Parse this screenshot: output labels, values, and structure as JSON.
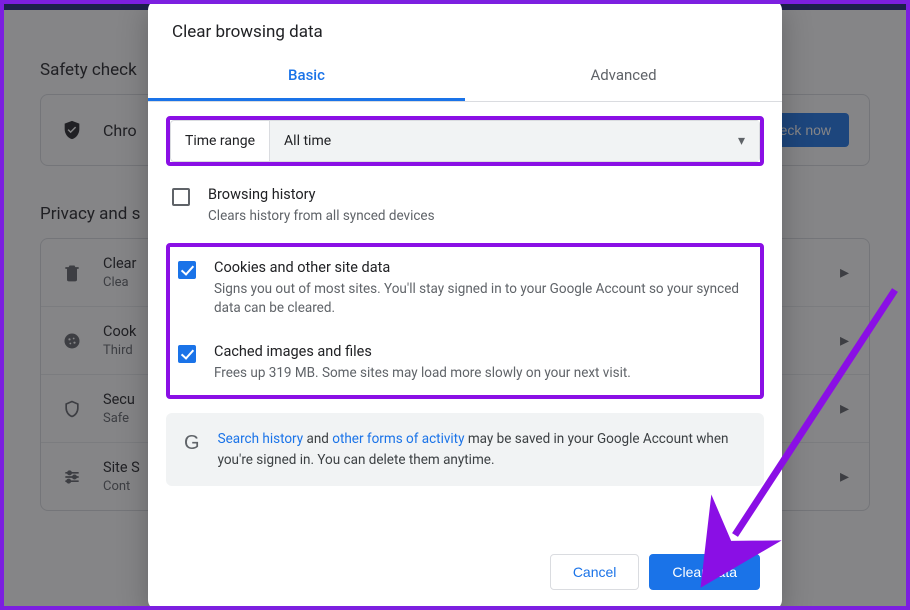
{
  "background": {
    "safety_heading": "Safety check",
    "safety_text": "Chro",
    "check_now": "eck now",
    "privacy_heading": "Privacy and s",
    "rows": [
      {
        "title": "Clear",
        "sub": "Clea"
      },
      {
        "title": "Cook",
        "sub": "Third"
      },
      {
        "title": "Secu",
        "sub": "Safe"
      },
      {
        "title": "Site S",
        "sub": "Cont"
      }
    ]
  },
  "dialog": {
    "title": "Clear browsing data",
    "tabs": {
      "basic": "Basic",
      "advanced": "Advanced"
    },
    "time_range": {
      "label": "Time range",
      "value": "All time"
    },
    "options": {
      "history": {
        "title": "Browsing history",
        "sub": "Clears history from all synced devices",
        "checked": false
      },
      "cookies": {
        "title": "Cookies and other site data",
        "sub": "Signs you out of most sites. You'll stay signed in to your Google Account so your synced data can be cleared.",
        "checked": true
      },
      "cache": {
        "title": "Cached images and files",
        "sub": "Frees up 319 MB. Some sites may load more slowly on your next visit.",
        "checked": true
      }
    },
    "info": {
      "link1": "Search history",
      "mid1": " and ",
      "link2": "other forms of activity",
      "rest": " may be saved in your Google Account when you're signed in. You can delete them anytime."
    },
    "buttons": {
      "cancel": "Cancel",
      "clear": "Clear data"
    }
  }
}
